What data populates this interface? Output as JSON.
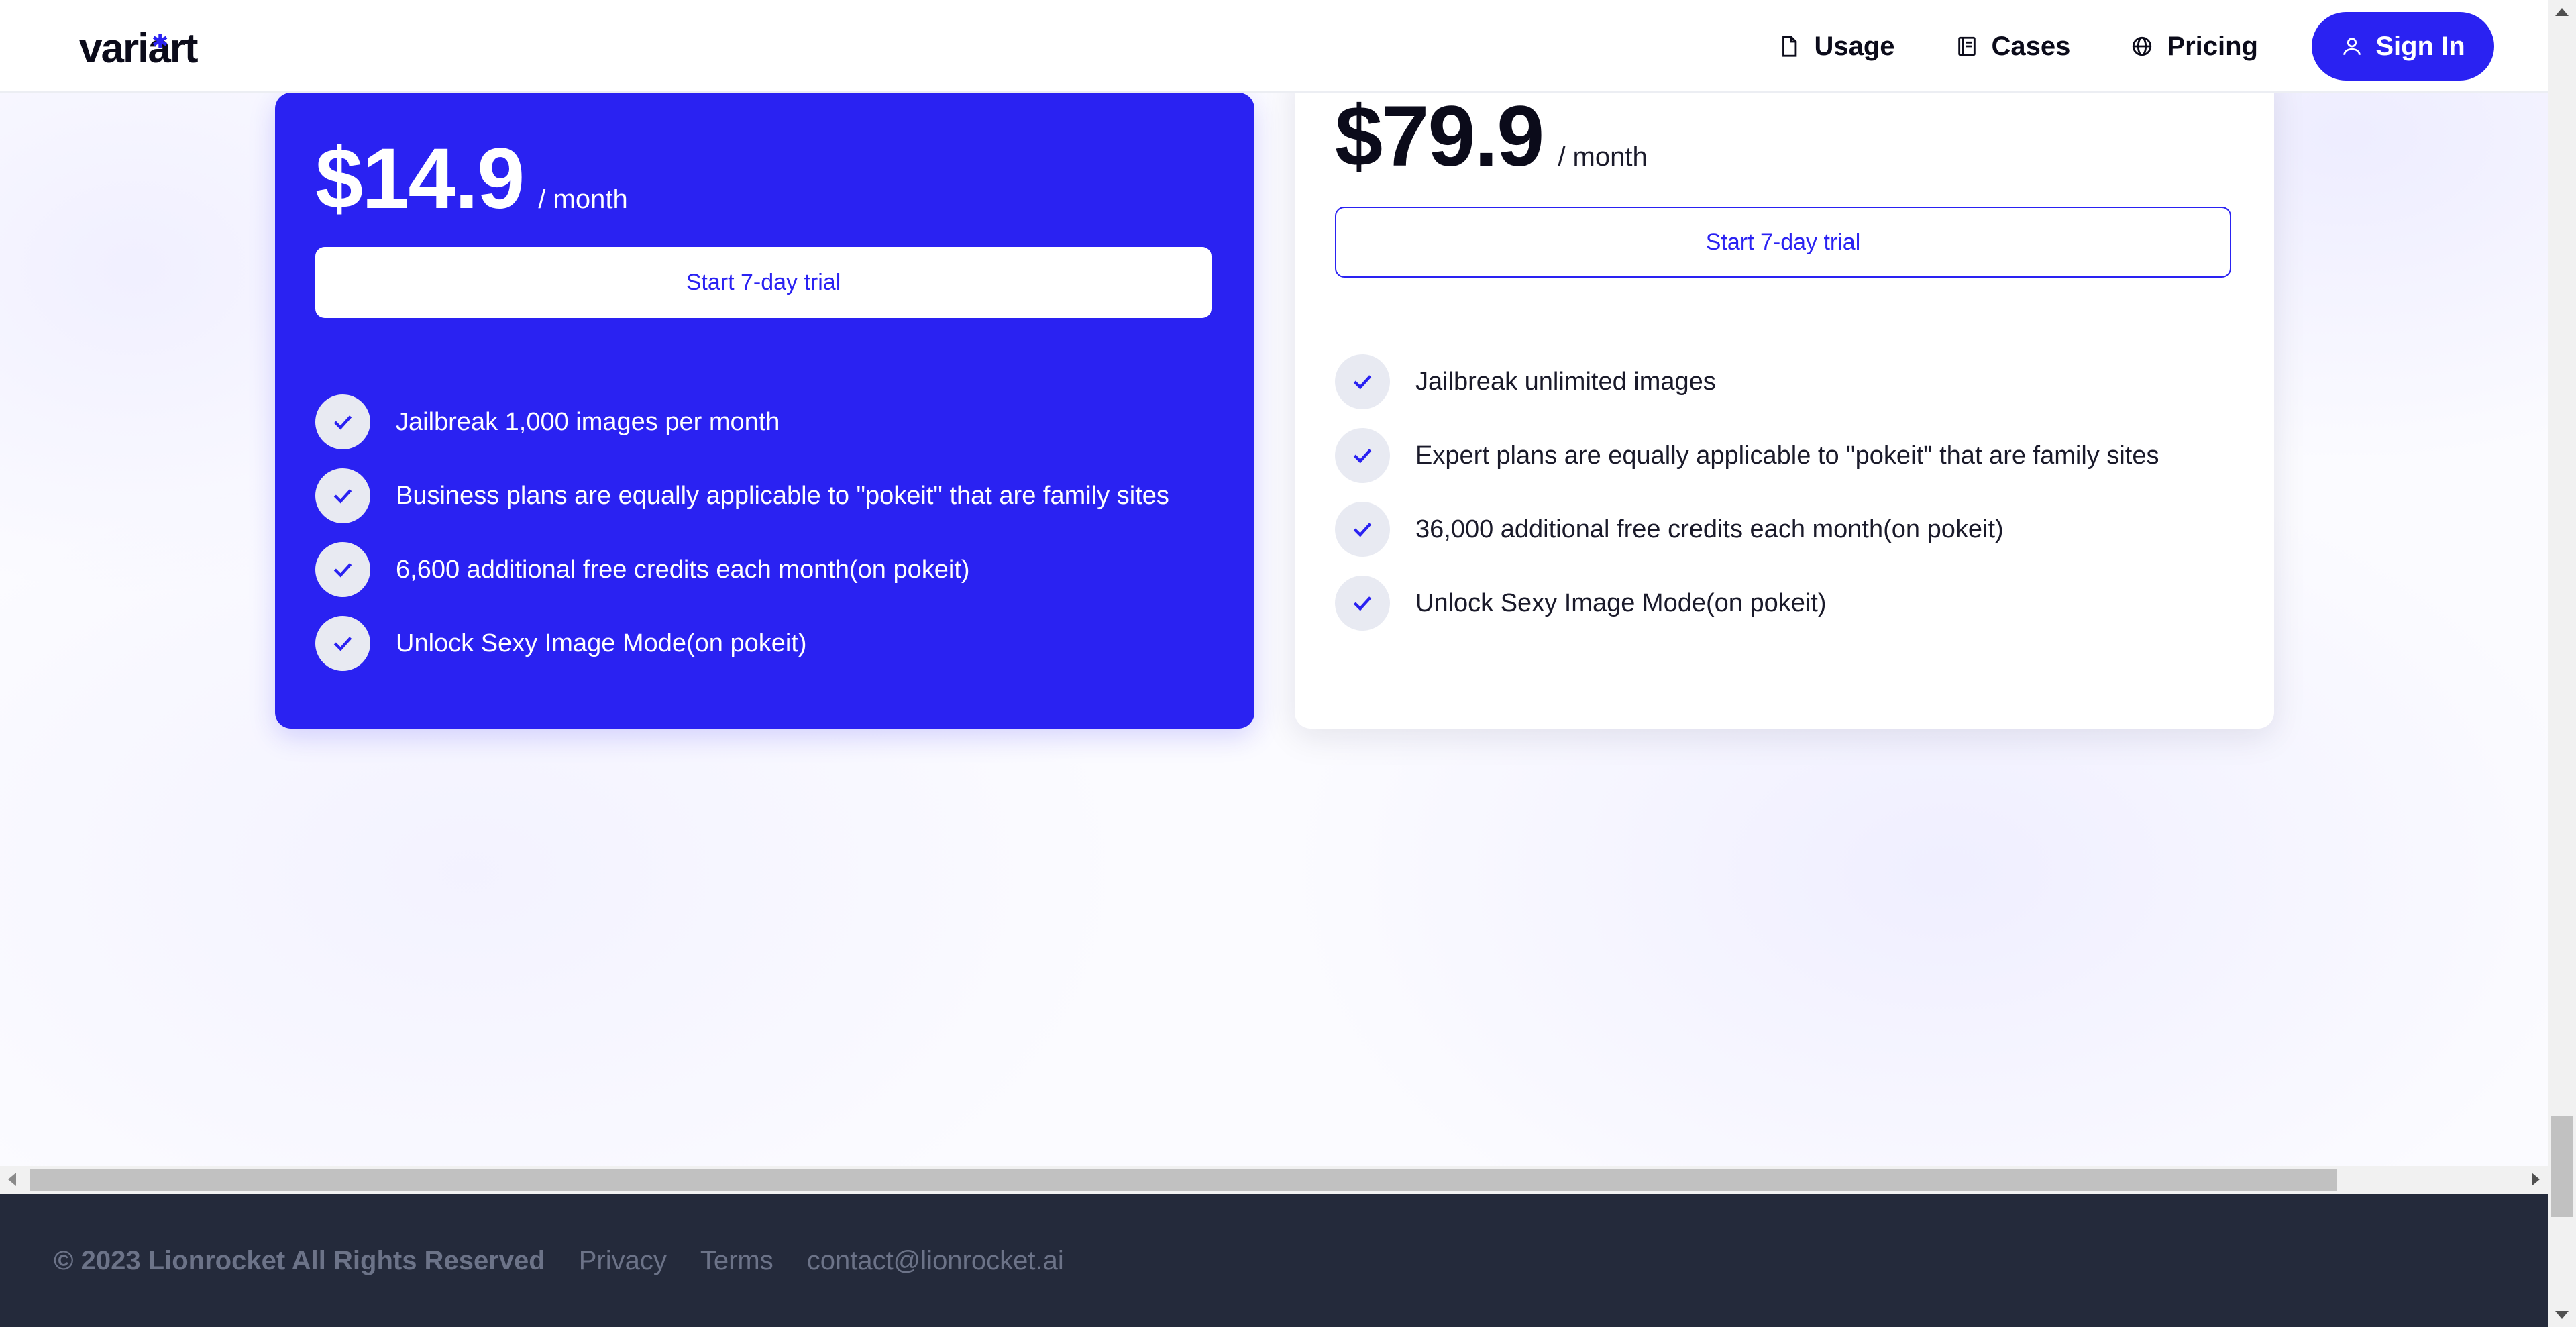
{
  "header": {
    "logo": "variart",
    "nav": [
      {
        "label": "Usage",
        "icon": "document-icon"
      },
      {
        "label": "Cases",
        "icon": "book-icon"
      },
      {
        "label": "Pricing",
        "icon": "globe-icon"
      }
    ],
    "sign_in": "Sign In"
  },
  "plans": [
    {
      "price": "$14.9",
      "unit": "/ month",
      "cta": "Start 7-day trial",
      "features": [
        "Jailbreak 1,000 images per month",
        "Business plans are equally applicable to \"pokeit\" that are family sites",
        "6,600 additional free credits each month(on pokeit)",
        "Unlock Sexy Image Mode(on pokeit)"
      ]
    },
    {
      "price": "$79.9",
      "unit": "/ month",
      "cta": "Start 7-day trial",
      "features": [
        "Jailbreak unlimited images",
        "Expert plans are equally applicable to \"pokeit\" that are family sites",
        "36,000 additional free credits each month(on pokeit)",
        "Unlock Sexy Image Mode(on pokeit)"
      ]
    }
  ],
  "footer": {
    "copyright": "© 2023 Lionrocket All Rights Reserved",
    "privacy": "Privacy",
    "terms": "Terms",
    "contact": "contact@lionrocket.ai"
  },
  "colors": {
    "accent": "#2a22f2",
    "footer_bg": "#242a3b",
    "footer_text": "#6c7388"
  }
}
